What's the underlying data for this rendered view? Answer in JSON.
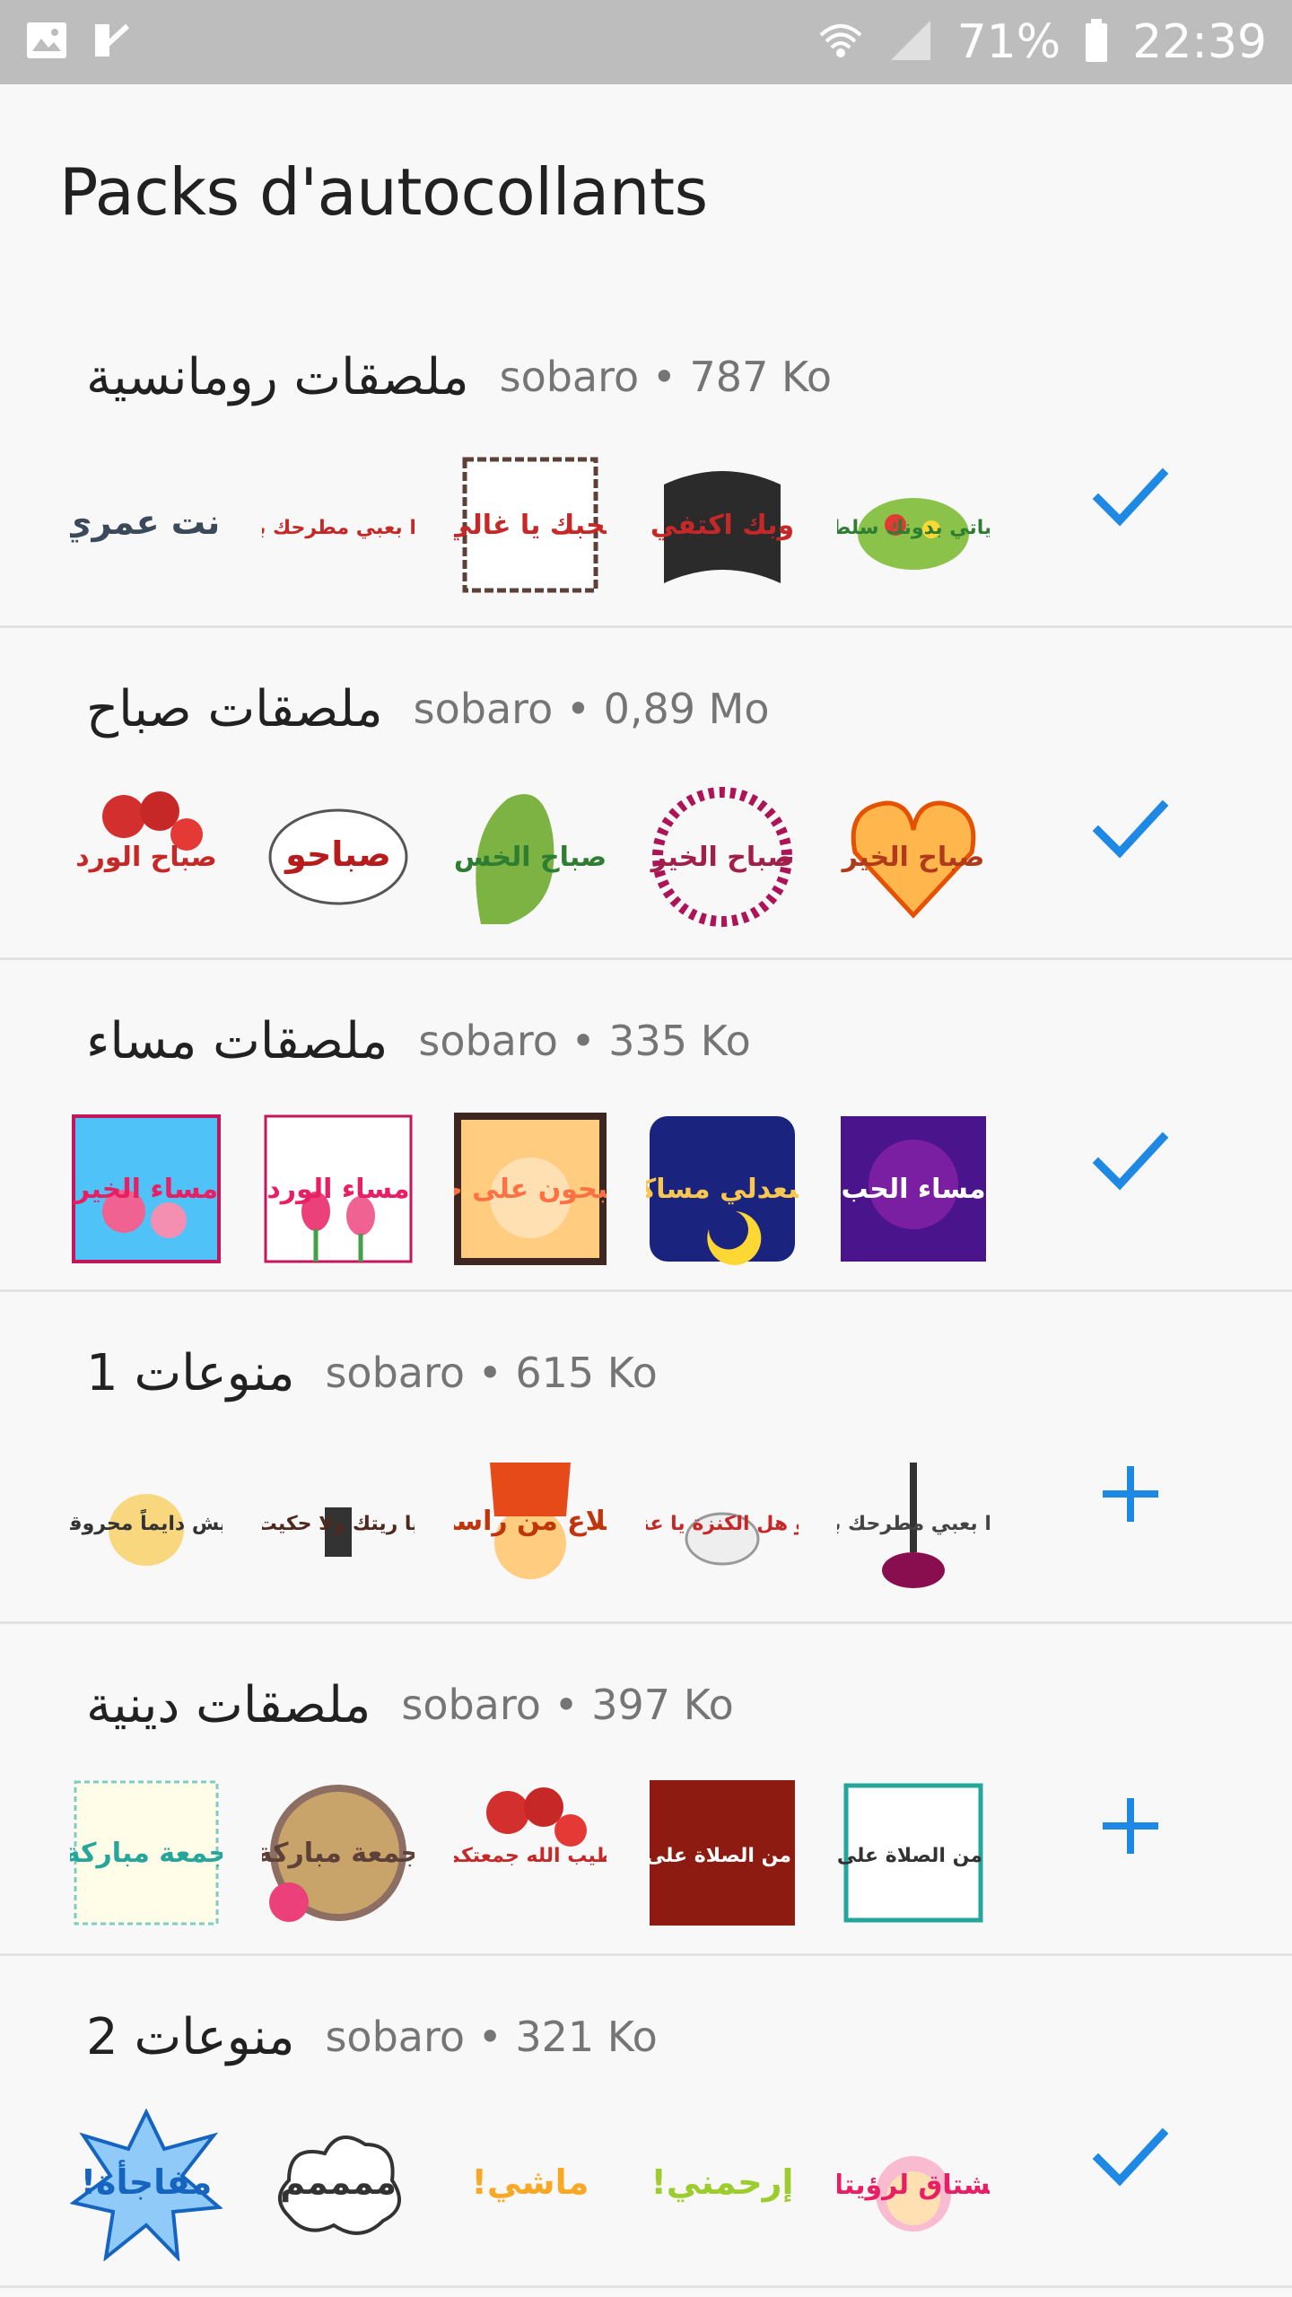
{
  "status_bar": {
    "battery": "71%",
    "time": "22:39"
  },
  "title": "Packs d'autocollants",
  "packs": [
    {
      "name": "ملصقات رومانسية",
      "meta": "sobaro • 787 Ko",
      "status": "added",
      "stickers": [
        {
          "label": "انت عمري",
          "color": "#3b4a5a",
          "bg": "none"
        },
        {
          "label": "ما حدا بعبي مطرحك بقلبي",
          "color": "#c62828",
          "bg": "none"
        },
        {
          "label": "بحبك يا غالي",
          "color": "#c62828",
          "bg": "frame"
        },
        {
          "label": "وبك اكتفي",
          "color": "#c62828",
          "bg": "hands"
        },
        {
          "label": "حياتي بدونك سلطة",
          "color": "#2e7d32",
          "bg": "salad"
        }
      ]
    },
    {
      "name": "ملصقات صباح",
      "meta": "sobaro • 0,89 Mo",
      "status": "added",
      "stickers": [
        {
          "label": "صباح الورد",
          "color": "#c62828",
          "bg": "roses"
        },
        {
          "label": "صباحو",
          "color": "#b71c1c",
          "bg": "oval"
        },
        {
          "label": "صباح الخس",
          "color": "#2e7d32",
          "bg": "lettuce"
        },
        {
          "label": "صباح الخير",
          "color": "#a0204a",
          "bg": "wreath"
        },
        {
          "label": "صباح الخير",
          "color": "#b03a1a",
          "bg": "heart"
        }
      ]
    },
    {
      "name": "ملصقات مساء",
      "meta": "sobaro • 335 Ko",
      "status": "added",
      "stickers": [
        {
          "label": "مساء الخير",
          "color": "#e91e63",
          "bg": "water"
        },
        {
          "label": "مساء الورد",
          "color": "#e91e63",
          "bg": "tulips"
        },
        {
          "label": "تصبحون على خير",
          "color": "#ff7043",
          "bg": "baby"
        },
        {
          "label": "يسعدلي مساكم",
          "color": "#f9c74f",
          "bg": "night"
        },
        {
          "label": "مساء الحب",
          "color": "#ffffff",
          "bg": "purple"
        }
      ]
    },
    {
      "name": "منوعات 1",
      "meta": "sobaro • 615 Ko",
      "status": "add",
      "stickers": [
        {
          "label": "ليش دايماً محروقة",
          "color": "#333333",
          "bg": "onion"
        },
        {
          "label": "يا ريتك ولا حكيت",
          "color": "#4e2a1e",
          "bg": "figure"
        },
        {
          "label": "طلاع من راسي",
          "color": "#bf360c",
          "bg": "head"
        },
        {
          "label": "شو هل الكنزة يا عنزة",
          "color": "#c62828",
          "bg": "goat"
        },
        {
          "label": "ما حدا بعبي مطرحك بقلبي",
          "color": "#444444",
          "bg": "hookah"
        }
      ]
    },
    {
      "name": "ملصقات دينية",
      "meta": "sobaro • 397 Ko",
      "status": "add",
      "stickers": [
        {
          "label": "جمعة مباركة",
          "color": "#26a69a",
          "bg": "colorful"
        },
        {
          "label": "جمعة مباركة",
          "color": "#5d4037",
          "bg": "wood"
        },
        {
          "label": "طيب الله جمعتكم",
          "color": "#c62828",
          "bg": "roses"
        },
        {
          "label": "اكثروا من الصلاة على النبي",
          "color": "#ffffff",
          "bg": "darkred"
        },
        {
          "label": "اكثروا من الصلاة على النبي",
          "color": "#333333",
          "bg": "greenframe"
        }
      ]
    },
    {
      "name": "منوعات 2",
      "meta": "sobaro • 321 Ko",
      "status": "added",
      "stickers": [
        {
          "label": "مفاجأة!",
          "color": "#1565c0",
          "bg": "burst"
        },
        {
          "label": "ممممم",
          "color": "#333333",
          "bg": "cloud"
        },
        {
          "label": "ماشي!",
          "color": "#f9a825",
          "bg": "none"
        },
        {
          "label": "إرحمني!",
          "color": "#9ccc2d",
          "bg": "none"
        },
        {
          "label": "مشتاق لرؤيتك",
          "color": "#e91e63",
          "bg": "girl"
        }
      ]
    }
  ],
  "colors": {
    "accent": "#1e88e5",
    "status_bar": "#bdbdbd",
    "background": "#f8f8f8",
    "divider": "#e3e3e3"
  },
  "icons": {
    "added": "check-icon",
    "add": "plus-icon"
  }
}
